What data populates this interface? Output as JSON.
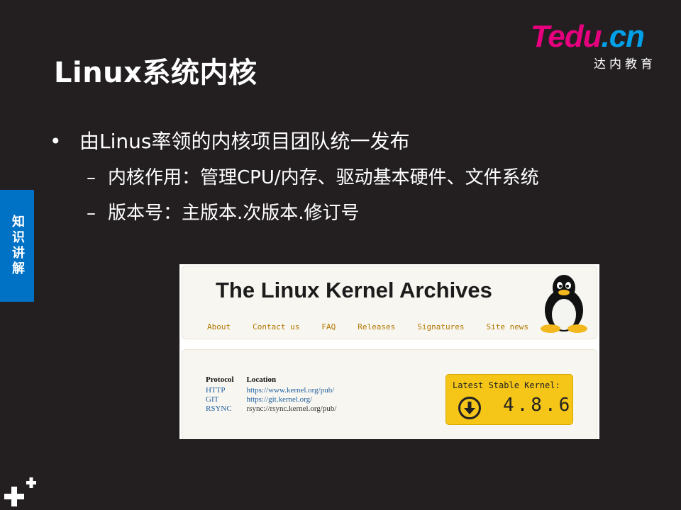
{
  "slide": {
    "title": "Linux系统内核",
    "bullets": {
      "l1": "由Linus率领的内核项目团队统一发布",
      "l2": [
        "内核作用：管理CPU/内存、驱动基本硬件、文件系统",
        "版本号：主版本.次版本.修订号"
      ]
    },
    "side_tab": "知识讲解",
    "bullet_symbol": "•",
    "dash_symbol": "–"
  },
  "logo": {
    "part1": "Tedu",
    "part2": ".cn",
    "subtitle": "达内教育"
  },
  "screenshot": {
    "title": "The Linux Kernel Archives",
    "nav": [
      "About",
      "Contact us",
      "FAQ",
      "Releases",
      "Signatures",
      "Site news"
    ],
    "protocol_table": {
      "headers": [
        "Protocol",
        "Location"
      ],
      "rows": [
        [
          "HTTP",
          "https://www.kernel.org/pub/"
        ],
        [
          "GIT",
          "https://git.kernel.org/"
        ],
        [
          "RSYNC",
          "rsync://rsync.kernel.org/pub/"
        ]
      ]
    },
    "stable": {
      "label": "Latest Stable Kernel:",
      "version": "4.8.6",
      "icon": "download-icon"
    }
  },
  "colors": {
    "background": "#231f20",
    "side_tab": "#0072c6",
    "logo_pink": "#e6007e",
    "logo_blue": "#00a0e9",
    "stable_yellow": "#f5c518",
    "nav_link": "#b07800"
  }
}
